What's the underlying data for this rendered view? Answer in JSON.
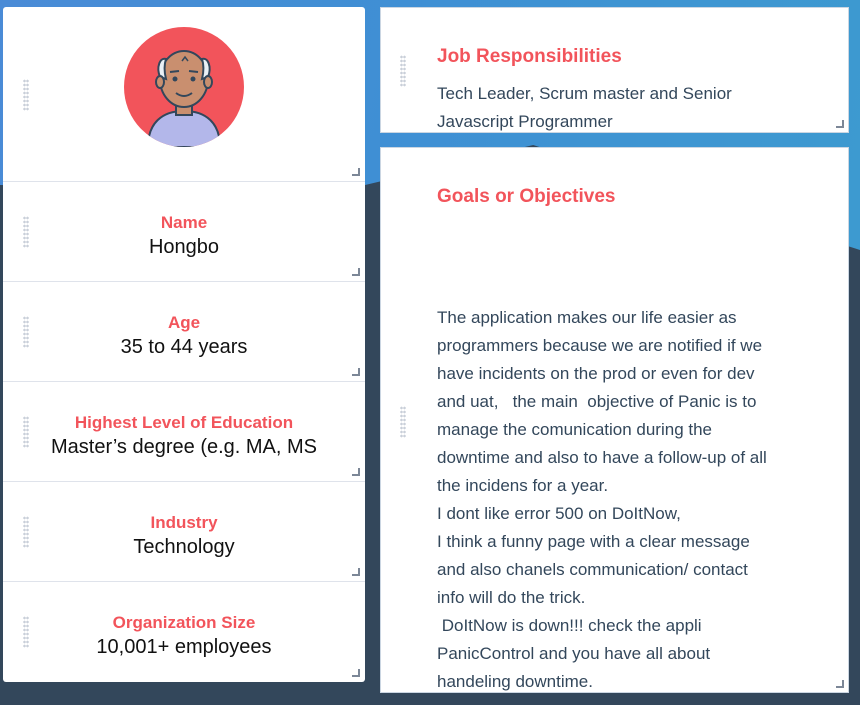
{
  "profile": {
    "avatar_alt": "",
    "fields": [
      {
        "label": "Name",
        "value": "Hongbo"
      },
      {
        "label": "Age",
        "value": "35 to 44 years"
      },
      {
        "label": "Highest Level of Education",
        "value": "Master’s degree (e.g. MA, MS"
      },
      {
        "label": "Industry",
        "value": "Technology"
      },
      {
        "label": "Organization Size",
        "value": "10,001+ employees"
      }
    ]
  },
  "job": {
    "title": "Job Responsibilities",
    "lines": [
      "Tech Leader, Scrum master and Senior",
      "Javascript Programmer"
    ]
  },
  "goals": {
    "title": "Goals or Objectives",
    "lines": [
      "The application makes our life easier as",
      "programmers because we are notified if we",
      "have incidents on the prod or even for dev",
      "and uat,   the main  objective of Panic is to",
      "manage the comunication during the",
      "downtime and also to have a follow-up of all",
      "the incidens for a year.",
      "I dont like error 500 on DoItNow,",
      "I think a funny page with a clear message",
      "and also chanels communication/ contact",
      "info will do the trick.",
      " DoItNow is down!!! check the appli",
      "PanicControl and you have all about",
      "handeling downtime."
    ]
  },
  "colors": {
    "accent": "#f2545b",
    "text": "#33475b",
    "background": "#33475b"
  }
}
